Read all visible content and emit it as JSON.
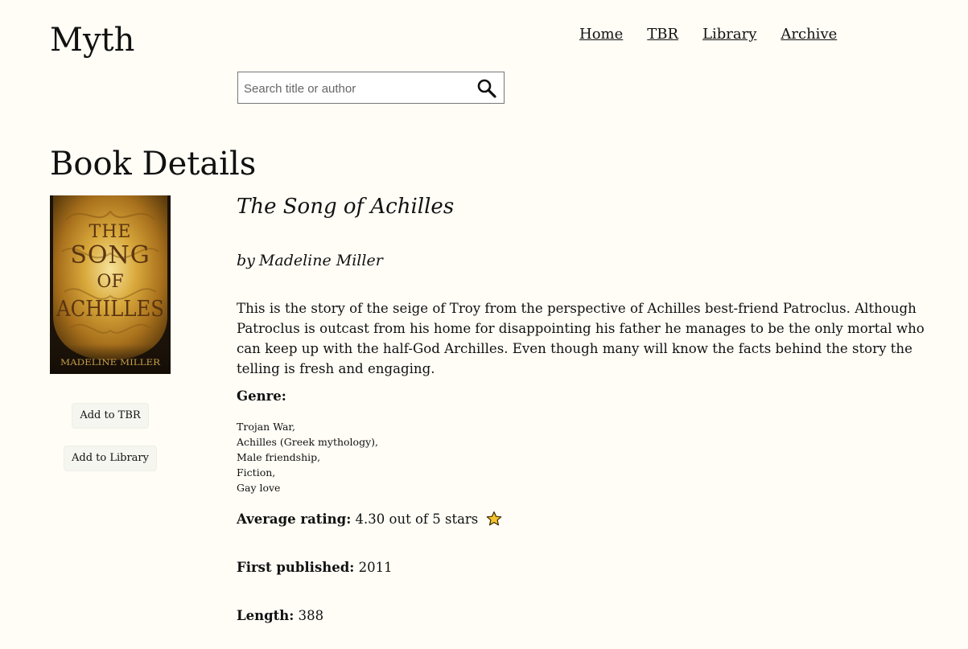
{
  "site": {
    "logo": "Myth"
  },
  "nav": {
    "items": [
      {
        "label": "Home"
      },
      {
        "label": "TBR"
      },
      {
        "label": "Library"
      },
      {
        "label": "Archive"
      }
    ]
  },
  "search": {
    "placeholder": "Search title or author",
    "value": "",
    "icon": "search-icon"
  },
  "page": {
    "title": "Book Details"
  },
  "book": {
    "title": "The Song of Achilles",
    "author_prefix": "by",
    "author": "Madeline Miller",
    "description": "This is the story of the seige of Troy from the perspective of Achilles best-friend Patroclus. Although Patroclus is outcast from his home for disappointing his father he manages to be the only mortal who can keep up with the half-God Archilles. Even though many will know the facts behind the story the telling is fresh and engaging.",
    "cover": {
      "title_lines": [
        "THE",
        "SONG",
        "OF",
        "ACHILLES"
      ],
      "author": "MADELINE MILLER"
    },
    "genre_label": "Genre:",
    "genres": [
      "Trojan War,",
      "Achilles (Greek mythology),",
      "Male friendship,",
      "Fiction,",
      "Gay love"
    ],
    "rating_label": "Average rating:",
    "rating_text": "4.30 out of 5 stars",
    "rating_value": 4.3,
    "rating_icon": "star-icon",
    "published_label": "First published:",
    "published_year": "2011",
    "length_label": "Length:",
    "length_pages": "388"
  },
  "actions": {
    "add_tbr": "Add to TBR",
    "add_library": "Add to Library"
  },
  "colors": {
    "background": "#fffdf6",
    "star_fill": "#f4c430",
    "cover_gold": "#c9962c"
  }
}
